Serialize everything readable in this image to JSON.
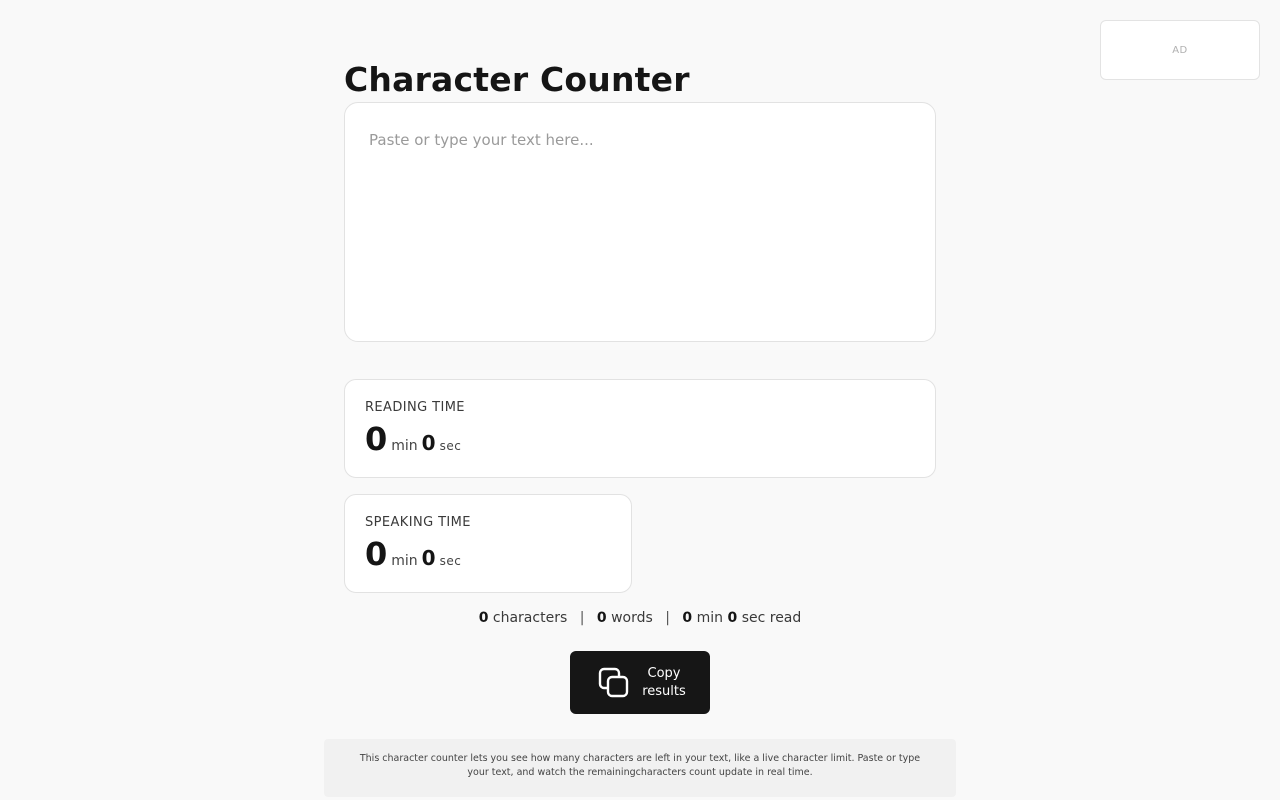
{
  "ad": {
    "label": "AD"
  },
  "title": "Character Counter",
  "editor": {
    "placeholder": "Paste or type your text here...",
    "value": ""
  },
  "reading_time": {
    "label": "READING TIME",
    "minutes": "0",
    "min_unit": "min",
    "seconds": "0",
    "sec_unit": "sec"
  },
  "speaking_time": {
    "label": "SPEAKING TIME",
    "minutes": "0",
    "min_unit": "min",
    "seconds": "0",
    "sec_unit": "sec"
  },
  "summary": {
    "characters": "0",
    "characters_label": "characters",
    "separator": "|",
    "words": "0",
    "words_label": "words",
    "read_minutes": "0",
    "read_min_label": "min",
    "read_seconds": "0",
    "read_sec_label": "sec read"
  },
  "copy_button": {
    "label": "Copy results",
    "icon": "copy-icon"
  },
  "footer": {
    "description": "This character counter lets you see how many characters are left in your text, like a live character limit. Paste or type your text, and watch the remainingcharacters count update in real time."
  },
  "colors": {
    "background": "#f9f9f9",
    "button": "#161616",
    "card_border": "#e2e2e2"
  }
}
